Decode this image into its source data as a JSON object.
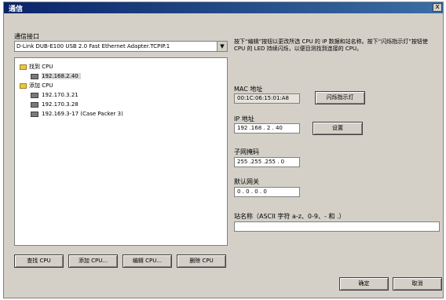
{
  "window": {
    "title": "通信",
    "close_label": "x"
  },
  "interface": {
    "label": "通信接口",
    "selected": "D-Link DUB-E100 USB 2.0 Fast Ethernet Adapter.TCPIP.1",
    "dropdown_glyph": "▼"
  },
  "tree": {
    "found_group": "找到 CPU",
    "found_items": [
      "192.168.2.40"
    ],
    "added_group": "添加 CPU",
    "added_items": [
      "192.170.3.21",
      "192.170.3.28",
      "192.169.3-17 (Case Packer 3)"
    ]
  },
  "bottom_buttons": {
    "find": "查找 CPU",
    "add": "添加 CPU...",
    "edit": "编辑 CPU...",
    "delete": "删除 CPU"
  },
  "description": "按下“编辑”按钮以更改所选 CPU 的 IP 数据和站名称。按下“闪烁指示灯”按钮使 CPU 的 LED 持续闪烁，以便目测找到连接的 CPU。",
  "mac": {
    "label": "MAC 地址",
    "value": "00:1C:06:15:01:A8",
    "blink_button": "闪烁指示灯"
  },
  "ip": {
    "label": "IP 地址",
    "value": "192 .168 . 2 . 40",
    "set_button": "设置"
  },
  "subnet": {
    "label": "子网掩码",
    "value": "255 .255 .255 . 0"
  },
  "gateway": {
    "label": "默认网关",
    "value": "0 . 0 . 0 . 0"
  },
  "station": {
    "label": "站名称（ASCII 字符 a-z、0-9、- 和 .）",
    "value": ""
  },
  "dialog_buttons": {
    "ok": "确定",
    "cancel": "取消"
  }
}
